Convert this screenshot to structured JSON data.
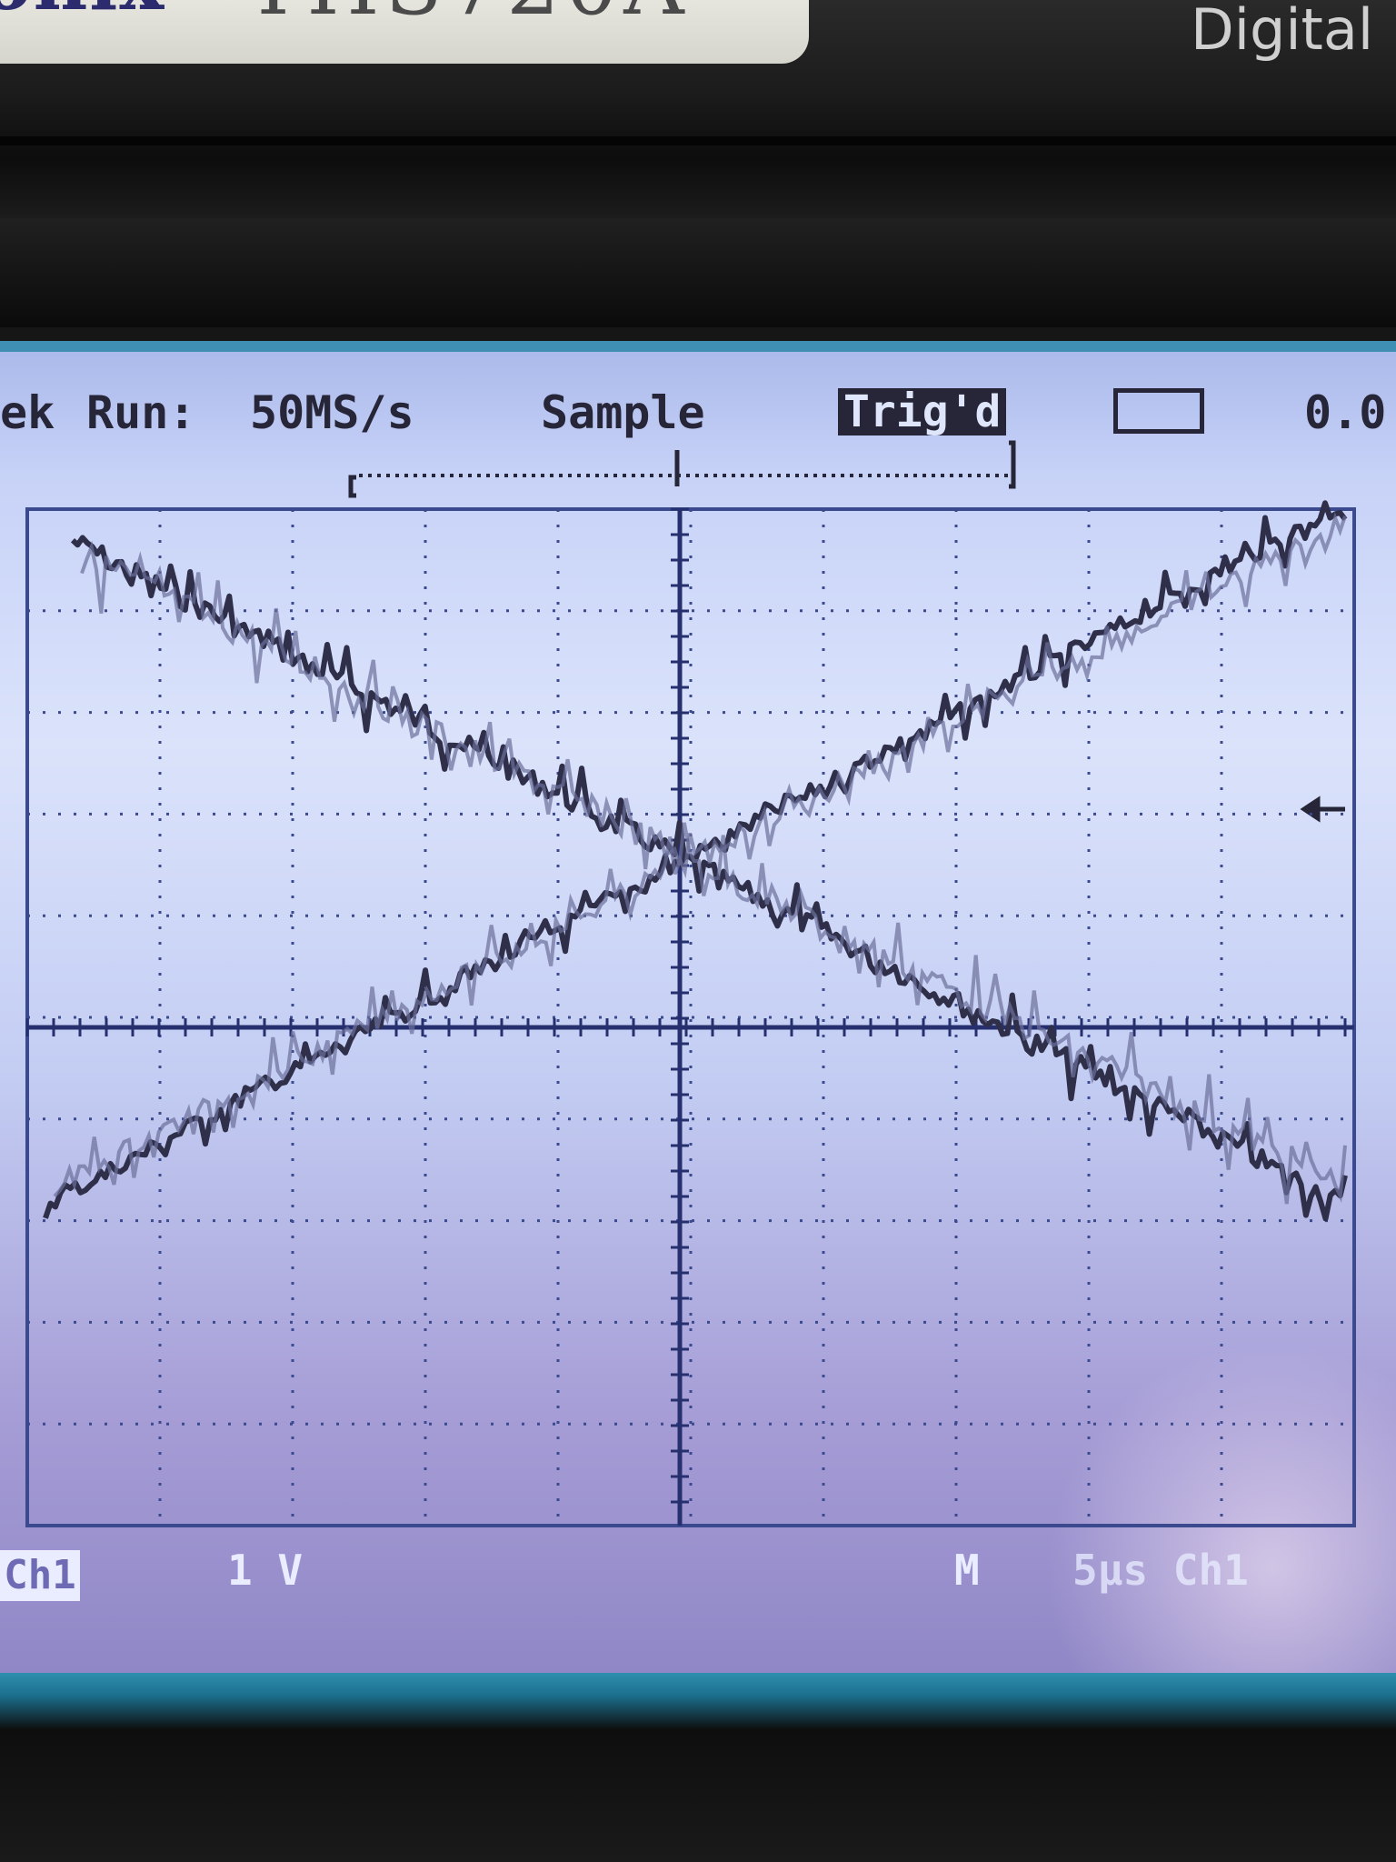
{
  "instrument": {
    "brand_fragment": "onix",
    "model": "THS720A",
    "label_fragment": "Digital"
  },
  "status": {
    "brand_fragment": "ek",
    "run_state": "Run:",
    "sample_rate": "50MS/s",
    "acquisition_mode": "Sample",
    "trigger_state": "Trig'd",
    "value_fragment": "0.0"
  },
  "readout": {
    "channel": "Ch1",
    "volts_per_div": "1 V",
    "horizontal_label": "M",
    "time_base_fragment": "5μs Ch1"
  },
  "colors": {
    "screen": "#c7d2f7",
    "trace": "#2f2f4a",
    "grid": "#3b4a8f"
  }
}
